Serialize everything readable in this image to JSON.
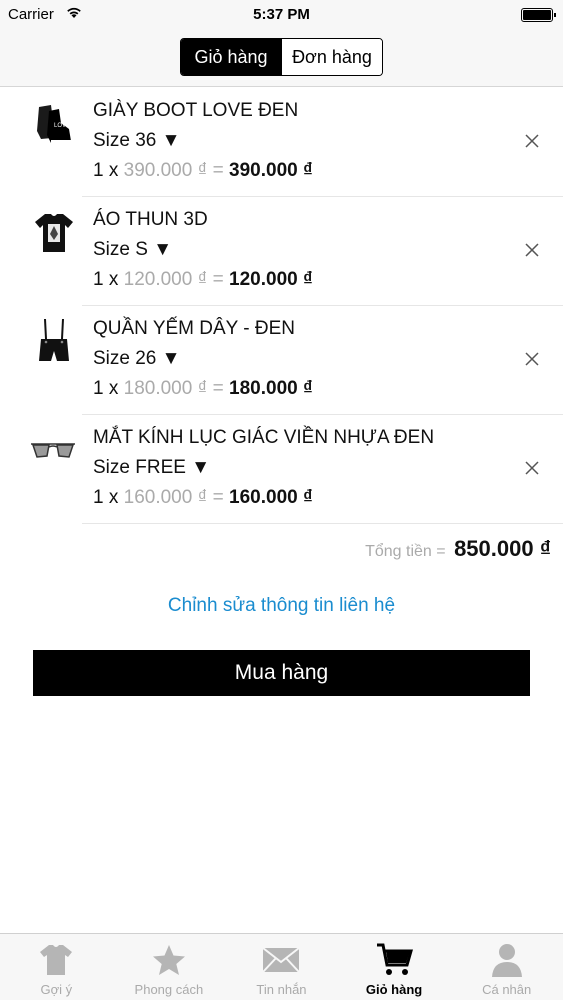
{
  "status_bar": {
    "carrier": "Carrier",
    "time": "5:37 PM"
  },
  "segment": {
    "cart_label": "Giỏ hàng",
    "orders_label": "Đơn hàng"
  },
  "cart_items": [
    {
      "name": "GIÀY BOOT LOVE ĐEN",
      "size": "Size 36 ▼",
      "qty": "1 x",
      "unit_price": "390.000 ₫",
      "eq": "=",
      "line_total": "390.000 ₫",
      "icon": "boot-icon"
    },
    {
      "name": "ÁO THUN 3D",
      "size": "Size S ▼",
      "qty": "1 x",
      "unit_price": "120.000 ₫",
      "eq": "=",
      "line_total": "120.000 ₫",
      "icon": "tshirt-icon"
    },
    {
      "name": "QUẦN YẾM DÂY - ĐEN",
      "size": "Size 26 ▼",
      "qty": "1 x",
      "unit_price": "180.000 ₫",
      "eq": "=",
      "line_total": "180.000 ₫",
      "icon": "overalls-icon"
    },
    {
      "name": "MẮT KÍNH LỤC GIÁC VIỀN NHỰA ĐEN",
      "size": "Size FREE ▼",
      "qty": "1 x",
      "unit_price": "160.000 ₫",
      "eq": "=",
      "line_total": "160.000 ₫",
      "icon": "glasses-icon"
    }
  ],
  "total": {
    "label": "Tổng tiền =",
    "value": "850.000 ₫"
  },
  "edit_contact_label": "Chỉnh sửa thông tin liên hệ",
  "buy_button_label": "Mua hàng",
  "tabs": [
    {
      "label": "Gợi ý",
      "icon": "tshirt-icon"
    },
    {
      "label": "Phong cách",
      "icon": "star-icon"
    },
    {
      "label": "Tin nhắn",
      "icon": "envelope-icon"
    },
    {
      "label": "Giỏ hàng",
      "icon": "cart-icon"
    },
    {
      "label": "Cá nhân",
      "icon": "person-icon"
    }
  ],
  "colors": {
    "accent": "#1a8ccf",
    "primary": "#000000",
    "muted": "#aaaaaa"
  }
}
